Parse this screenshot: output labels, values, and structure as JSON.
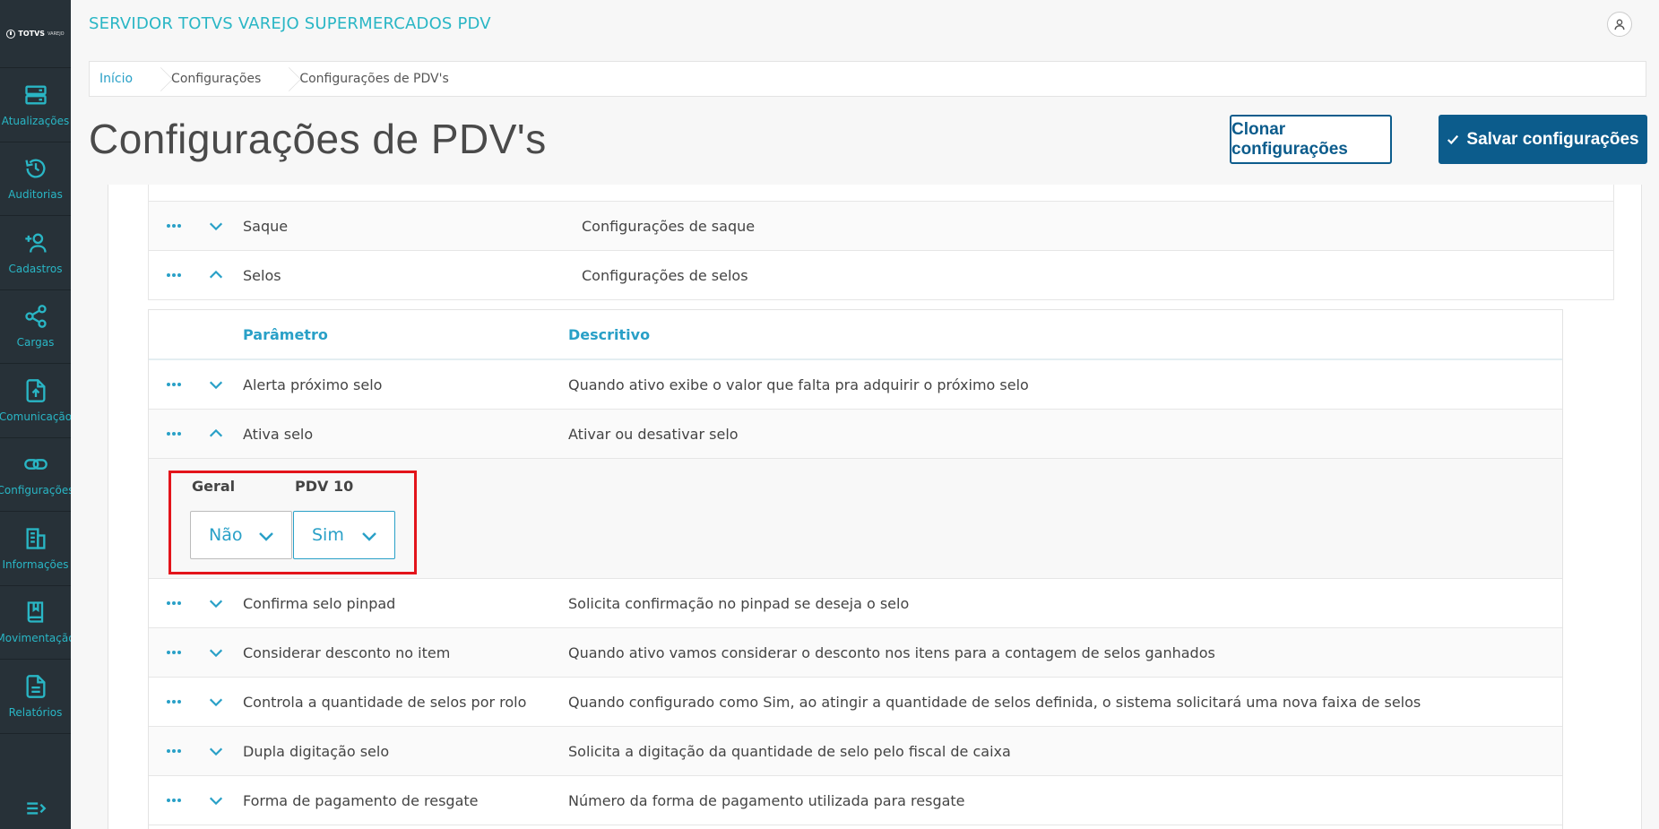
{
  "app": {
    "logo_text": "TOTVS",
    "logo_sub": "VAREJO",
    "title": "SERVIDOR TOTVS VAREJO SUPERMERCADOS PDV"
  },
  "sidebar": {
    "items": [
      {
        "label": "Atualizações",
        "icon": "server-icon"
      },
      {
        "label": "Auditorias",
        "icon": "history-icon"
      },
      {
        "label": "Cadastros",
        "icon": "user-plus-icon"
      },
      {
        "label": "Cargas",
        "icon": "share-icon"
      },
      {
        "label": "Comunicação",
        "icon": "file-upload-icon"
      },
      {
        "label": "Configurações",
        "icon": "link-icon"
      },
      {
        "label": "Informações",
        "icon": "building-icon"
      },
      {
        "label": "Movimentação",
        "icon": "book-icon"
      },
      {
        "label": "Relatórios",
        "icon": "document-icon"
      }
    ]
  },
  "breadcrumb": [
    "Início",
    "Configurações",
    "Configurações de PDV's"
  ],
  "page": {
    "title": "Configurações de PDV's",
    "clone_label": "Clonar configurações",
    "save_label": "Salvar configurações"
  },
  "outer_rows": [
    {
      "name": "Saque",
      "desc": "Configurações de saque",
      "expanded": false
    },
    {
      "name": "Selos",
      "desc": "Configurações de selos",
      "expanded": true
    }
  ],
  "inner": {
    "headers": {
      "param": "Parâmetro",
      "desc": "Descritivo"
    },
    "rows": [
      {
        "name": "Alerta próximo selo",
        "desc": "Quando ativo exibe o valor que falta pra adquirir o próximo selo",
        "expanded": false
      },
      {
        "name": "Ativa selo",
        "desc": "Ativar ou desativar selo",
        "expanded": true
      },
      {
        "name": "Confirma selo pinpad",
        "desc": "Solicita confirmação no pinpad se deseja o selo",
        "expanded": false
      },
      {
        "name": "Considerar desconto no item",
        "desc": "Quando ativo vamos considerar o desconto nos itens para a contagem de selos ganhados",
        "expanded": false
      },
      {
        "name": "Controla a quantidade de selos por rolo",
        "desc": "Quando configurado como Sim, ao atingir a quantidade de selos definida, o sistema solicitará uma nova faixa de selos",
        "expanded": false
      },
      {
        "name": "Dupla digitação selo",
        "desc": "Solicita a digitação da quantidade de selo pelo fiscal de caixa",
        "expanded": false
      },
      {
        "name": "Forma de pagamento de resgate",
        "desc": "Número da forma de pagamento utilizada para resgate",
        "expanded": false
      }
    ],
    "expanded_fields": [
      {
        "label": "Geral",
        "value": "Não"
      },
      {
        "label": "PDV 10",
        "value": "Sim"
      }
    ]
  },
  "colors": {
    "accent": "#29b6c5",
    "primary": "#0c5c8c",
    "highlight": "#e3141b",
    "sidebar": "#273138"
  }
}
